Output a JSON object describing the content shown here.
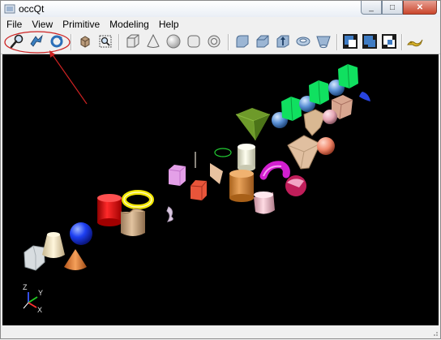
{
  "window": {
    "title": "occQt"
  },
  "menu": [
    "File",
    "View",
    "Primitive",
    "Modeling",
    "Help"
  ],
  "toolbar": {
    "view_tools": [
      "zoom-icon",
      "pan-icon",
      "rotate-icon"
    ],
    "misc_tools": [
      "fit-all-icon",
      "zoom-window-icon"
    ],
    "primitive_tools": [
      "box-icon",
      "cone-icon",
      "sphere-icon",
      "cylinder-icon",
      "torus-icon"
    ],
    "modeling_tools": [
      "fillet-icon",
      "chamfer-icon",
      "extrude-icon",
      "revolve-icon",
      "loft-icon"
    ],
    "boolean_tools": [
      "cut-icon",
      "fuse-icon",
      "common-icon"
    ],
    "help_tools": [
      "helix-icon"
    ]
  },
  "axes": {
    "z": "Z",
    "y": "Y",
    "x": "X"
  },
  "colors": {
    "viewport_bg": "#000000",
    "annotation": "#cc2222"
  }
}
